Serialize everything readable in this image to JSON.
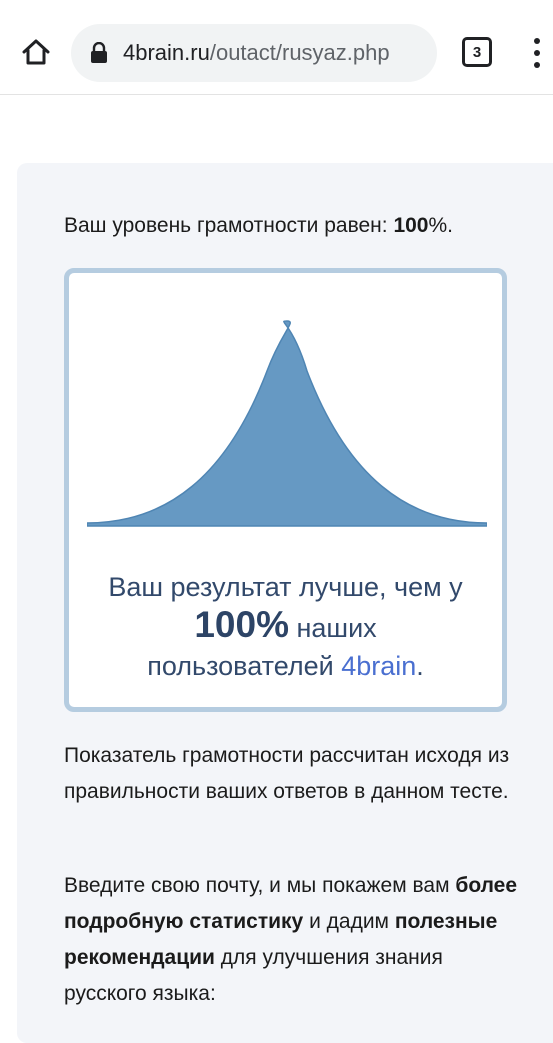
{
  "browser": {
    "url_domain": "4brain.ru",
    "url_path": "/outact/rusyaz.php",
    "tab_count": "3",
    "icons": {
      "home": "home-icon",
      "lock": "lock-icon",
      "tabs": "tab-switcher-icon",
      "menu": "more-vert-icon"
    }
  },
  "level": {
    "prefix": "Ваш уровень грамотности равен: ",
    "value": "100",
    "suffix": "%."
  },
  "result": {
    "line1": "Ваш результат лучше, чем у",
    "percent": "100%",
    "line2_rest": " наших",
    "line3": "пользователей ",
    "brand": "4brain",
    "end": "."
  },
  "paragraph1": "Показатель грамотности рассчитан исходя из правильности ваших ответов в данном тесте.",
  "paragraph2": {
    "part1": "Введите свою почту, и мы покажем вам ",
    "bold1": "более подробную статистику",
    "part2": " и дадим ",
    "bold2": "полезные рекомендации",
    "part3": " для улучшения знания русского языка:"
  },
  "colors": {
    "curve_fill": "#6699c3",
    "curve_stroke": "#4f85b3",
    "box_border": "#b5cce0",
    "card_bg": "#f3f5f9",
    "result_text": "#32496b",
    "brand_link": "#4a6fd0"
  }
}
